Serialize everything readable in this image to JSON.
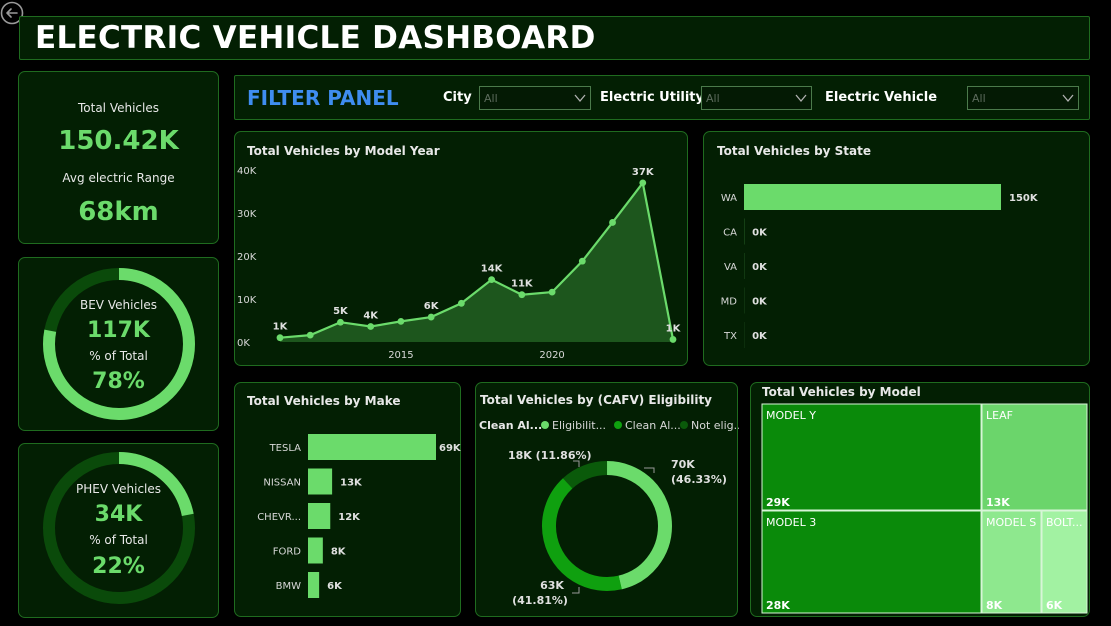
{
  "dashboard": {
    "title": "ELECTRIC VEHICLE DASHBOARD"
  },
  "kpi": {
    "total_label": "Total Vehicles",
    "total_value": "150.42K",
    "range_label": "Avg electric Range",
    "range_value": "68km"
  },
  "bev": {
    "label": "BEV Vehicles",
    "value": "117K",
    "pct_label": "% of Total",
    "pct_value": "78%",
    "fraction": 0.78
  },
  "phev": {
    "label": "PHEV Vehicles",
    "value": "34K",
    "pct_label": "% of Total",
    "pct_value": "22%",
    "fraction": 0.22
  },
  "filter": {
    "title": "FILTER PANEL",
    "city_label": "City",
    "city_value": "All",
    "utility_label": "Electric Utility",
    "utility_value": "All",
    "vehicle_label": "Electric Vehicle",
    "vehicle_value": "All"
  },
  "colors": {
    "bg": "#000000",
    "panel": "#031f03",
    "accent": "#6bdb6b",
    "dark_green": "#0a4a0a",
    "filter_title": "#3f8df0"
  },
  "chart_data": [
    {
      "id": "model_year",
      "type": "area",
      "title": "Total Vehicles by Model Year",
      "xlim": [
        2011,
        2024
      ],
      "ylim": [
        0,
        40000
      ],
      "yticks": [
        0,
        10000,
        20000,
        30000,
        40000
      ],
      "ytick_labels": [
        "0K",
        "10K",
        "20K",
        "30K",
        "40K"
      ],
      "xticks": [
        2015,
        2020
      ],
      "x": [
        2011,
        2012,
        2013,
        2014,
        2015,
        2016,
        2017,
        2018,
        2019,
        2020,
        2021,
        2022,
        2023,
        2024
      ],
      "values": [
        1000,
        1600,
        4600,
        3600,
        4800,
        5800,
        9000,
        14500,
        11000,
        11600,
        18800,
        27800,
        37000,
        600
      ],
      "labels": [
        "1K",
        "",
        "5K",
        "4K",
        "",
        "6K",
        "",
        "14K",
        "11K",
        "",
        "",
        "",
        "37K",
        "1K"
      ]
    },
    {
      "id": "state",
      "type": "bar",
      "orientation": "horizontal",
      "title": "Total Vehicles by State",
      "categories": [
        "WA",
        "CA",
        "VA",
        "MD",
        "TX"
      ],
      "values": [
        150000,
        100,
        80,
        60,
        50
      ],
      "labels": [
        "150K",
        "0K",
        "0K",
        "0K",
        "0K"
      ],
      "xlim": [
        0,
        150000
      ]
    },
    {
      "id": "make",
      "type": "bar",
      "orientation": "horizontal",
      "title": "Total Vehicles by Make",
      "categories": [
        "TESLA",
        "NISSAN",
        "CHEVR...",
        "FORD",
        "BMW"
      ],
      "values": [
        69000,
        13000,
        12000,
        8000,
        6000
      ],
      "labels": [
        "69K",
        "13K",
        "12K",
        "8K",
        "6K"
      ],
      "xlim": [
        0,
        69000
      ]
    },
    {
      "id": "cafv",
      "type": "pie",
      "title": "Total Vehicles by (CAFV) Eligibility",
      "legend_title": "Clean Al...",
      "legend": [
        "Eligibilit...",
        "Clean Al...",
        "Not elig..."
      ],
      "values": [
        46.33,
        41.81,
        11.86
      ],
      "value_labels": [
        "70K",
        "63K",
        "18K (11.86%)"
      ],
      "pct_labels": [
        "(46.33%)",
        "(41.81%)",
        ""
      ],
      "colors": [
        "#6bdb6b",
        "#0fa00f",
        "#0a5a0a"
      ]
    },
    {
      "id": "model",
      "type": "treemap",
      "title": "Total Vehicles by Model",
      "items": [
        {
          "name": "MODEL Y",
          "label": "29K",
          "value": 29000,
          "color": "#0a8a0a"
        },
        {
          "name": "LEAF",
          "label": "13K",
          "value": 13000,
          "color": "#6bd56b"
        },
        {
          "name": "MODEL 3",
          "label": "28K",
          "value": 28000,
          "color": "#0a8a0a"
        },
        {
          "name": "MODEL S",
          "label": "8K",
          "value": 8000,
          "color": "#8ee88e"
        },
        {
          "name": "BOLT...",
          "label": "6K",
          "value": 6000,
          "color": "#a2f2a2"
        }
      ]
    }
  ]
}
